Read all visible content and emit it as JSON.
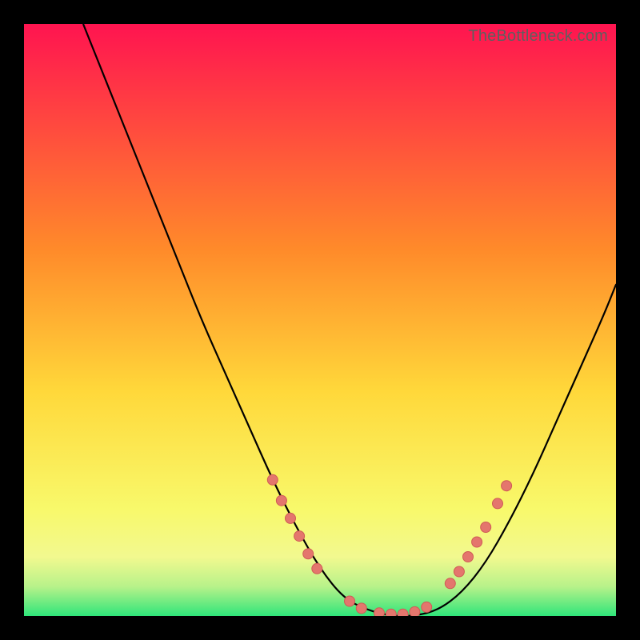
{
  "watermark": "TheBottleneck.com",
  "colors": {
    "bg": "#000000",
    "grad_top": "#ff1450",
    "grad_mid1": "#ff8a2a",
    "grad_mid2": "#ffd83a",
    "grad_mid3": "#f8f96b",
    "grad_bottom": "#2fe57a",
    "curve": "#000000",
    "marker_fill": "#e4766d",
    "marker_stroke": "#cf5b55"
  },
  "chart_data": {
    "type": "line",
    "title": "",
    "xlabel": "",
    "ylabel": "",
    "xlim": [
      0,
      100
    ],
    "ylim": [
      0,
      100
    ],
    "series": [
      {
        "name": "bottleneck-curve",
        "x": [
          10,
          14,
          18,
          22,
          26,
          30,
          34,
          38,
          42,
          46,
          50,
          54,
          58,
          62,
          66,
          70,
          74,
          78,
          82,
          86,
          90,
          94,
          98,
          100
        ],
        "y": [
          100,
          90,
          80,
          70,
          60,
          50,
          41,
          32,
          23,
          15,
          8,
          3,
          1,
          0,
          0,
          1,
          4,
          9,
          16,
          24,
          33,
          42,
          51,
          56
        ]
      }
    ],
    "markers": {
      "name": "highlight-segments",
      "points": [
        {
          "x": 42,
          "y": 23
        },
        {
          "x": 43.5,
          "y": 19.5
        },
        {
          "x": 45,
          "y": 16.5
        },
        {
          "x": 46.5,
          "y": 13.5
        },
        {
          "x": 48,
          "y": 10.5
        },
        {
          "x": 49.5,
          "y": 8
        },
        {
          "x": 55,
          "y": 2.5
        },
        {
          "x": 57,
          "y": 1.3
        },
        {
          "x": 60,
          "y": 0.5
        },
        {
          "x": 62,
          "y": 0.3
        },
        {
          "x": 64,
          "y": 0.3
        },
        {
          "x": 66,
          "y": 0.7
        },
        {
          "x": 68,
          "y": 1.5
        },
        {
          "x": 72,
          "y": 5.5
        },
        {
          "x": 73.5,
          "y": 7.5
        },
        {
          "x": 75,
          "y": 10
        },
        {
          "x": 76.5,
          "y": 12.5
        },
        {
          "x": 78,
          "y": 15
        },
        {
          "x": 80,
          "y": 19
        },
        {
          "x": 81.5,
          "y": 22
        }
      ]
    },
    "gradient_bands": [
      {
        "y": 100,
        "color": "#ff1450"
      },
      {
        "y": 55,
        "color": "#ffb030"
      },
      {
        "y": 30,
        "color": "#fff05a"
      },
      {
        "y": 12,
        "color": "#f6f97a"
      },
      {
        "y": 0,
        "color": "#2fe57a"
      }
    ]
  }
}
